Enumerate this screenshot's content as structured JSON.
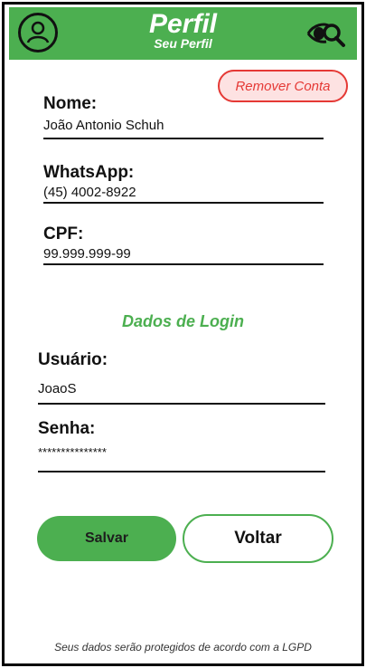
{
  "header": {
    "title": "Perfil",
    "subtitle": "Seu Perfil",
    "avatar_icon": "user-circle-icon",
    "search_icon": "eye-search-icon",
    "bg_color": "#4caf50"
  },
  "actions": {
    "remove_account": "Remover Conta",
    "save": "Salvar",
    "back": "Voltar"
  },
  "profile": {
    "name_label": "Nome:",
    "name_value": "João Antonio Schuh",
    "whatsapp_label": "WhatsApp:",
    "whatsapp_value": "(45) 4002-8922",
    "cpf_label": "CPF:",
    "cpf_value": "99.999.999-99"
  },
  "login": {
    "section_title": "Dados de Login",
    "user_label": "Usuário:",
    "user_value": "JoaoS",
    "password_label": "Senha:",
    "password_value": "***************"
  },
  "footer": {
    "text": "Seus dados serão protegidos de acordo com a LGPD"
  },
  "colors": {
    "accent": "#4caf50",
    "danger": "#e53935",
    "danger_bg": "#fde2e2"
  }
}
